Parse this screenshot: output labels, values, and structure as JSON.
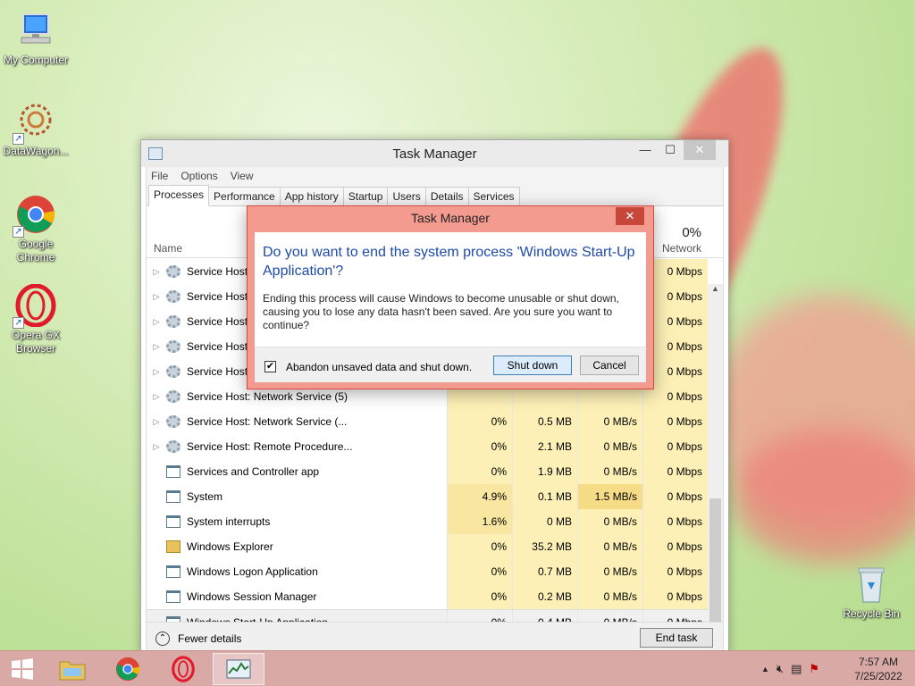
{
  "desktop": {
    "icons": [
      {
        "label": "My Computer",
        "icon": "computer-icon"
      },
      {
        "label": "DataWagon...",
        "icon": "datawagon-icon"
      },
      {
        "label": "Google Chrome",
        "icon": "chrome-icon"
      },
      {
        "label": "Opera GX Browser",
        "icon": "opera-gx-icon"
      },
      {
        "label": "Recycle Bin",
        "icon": "recycle-bin-icon"
      }
    ]
  },
  "task_manager": {
    "title": "Task Manager",
    "menu": [
      "File",
      "Options",
      "View"
    ],
    "tabs": [
      "Processes",
      "Performance",
      "App history",
      "Startup",
      "Users",
      "Details",
      "Services"
    ],
    "active_tab": "Processes",
    "columns": {
      "name": "Name",
      "network_pct": "0%",
      "network": "Network"
    },
    "processes": [
      {
        "name": "Service Host: ...",
        "cpu": "",
        "memory": "",
        "disk": "",
        "network": "0 Mbps",
        "expandable": true,
        "icon": "gear-icon"
      },
      {
        "name": "Service Host: ...",
        "cpu": "",
        "memory": "",
        "disk": "",
        "network": "0 Mbps",
        "expandable": true,
        "icon": "gear-icon"
      },
      {
        "name": "Service Host: ...",
        "cpu": "",
        "memory": "",
        "disk": "",
        "network": "0 Mbps",
        "expandable": true,
        "icon": "gear-icon"
      },
      {
        "name": "Service Host: ...",
        "cpu": "",
        "memory": "",
        "disk": "",
        "network": "0 Mbps",
        "expandable": true,
        "icon": "gear-icon"
      },
      {
        "name": "Service Host: ...",
        "cpu": "",
        "memory": "",
        "disk": "",
        "network": "0 Mbps",
        "expandable": true,
        "icon": "gear-icon"
      },
      {
        "name": "Service Host: Network Service (5)",
        "cpu": "",
        "memory": "",
        "disk": "",
        "network": "0 Mbps",
        "expandable": true,
        "icon": "gear-icon"
      },
      {
        "name": "Service Host: Network Service (...",
        "cpu": "0%",
        "memory": "0.5 MB",
        "disk": "0 MB/s",
        "network": "0 Mbps",
        "expandable": true,
        "icon": "gear-icon"
      },
      {
        "name": "Service Host: Remote Procedure...",
        "cpu": "0%",
        "memory": "2.1 MB",
        "disk": "0 MB/s",
        "network": "0 Mbps",
        "expandable": true,
        "icon": "gear-icon"
      },
      {
        "name": "Services and Controller app",
        "cpu": "0%",
        "memory": "1.9 MB",
        "disk": "0 MB/s",
        "network": "0 Mbps",
        "expandable": false,
        "icon": "app-window-icon"
      },
      {
        "name": "System",
        "cpu": "4.9%",
        "memory": "0.1 MB",
        "disk": "1.5 MB/s",
        "network": "0 Mbps",
        "expandable": false,
        "icon": "app-window-icon"
      },
      {
        "name": "System interrupts",
        "cpu": "1.6%",
        "memory": "0 MB",
        "disk": "0 MB/s",
        "network": "0 Mbps",
        "expandable": false,
        "icon": "app-window-icon"
      },
      {
        "name": "Windows Explorer",
        "cpu": "0%",
        "memory": "35.2 MB",
        "disk": "0 MB/s",
        "network": "0 Mbps",
        "expandable": false,
        "icon": "folder-icon"
      },
      {
        "name": "Windows Logon Application",
        "cpu": "0%",
        "memory": "0.7 MB",
        "disk": "0 MB/s",
        "network": "0 Mbps",
        "expandable": false,
        "icon": "app-window-icon"
      },
      {
        "name": "Windows Session Manager",
        "cpu": "0%",
        "memory": "0.2 MB",
        "disk": "0 MB/s",
        "network": "0 Mbps",
        "expandable": false,
        "icon": "app-window-icon"
      },
      {
        "name": "Windows Start-Up Application",
        "cpu": "0%",
        "memory": "0.4 MB",
        "disk": "0 MB/s",
        "network": "0 Mbps",
        "expandable": false,
        "icon": "app-window-icon",
        "selected": true
      }
    ],
    "fewer_details": "Fewer details",
    "end_task": "End task"
  },
  "dialog": {
    "title": "Task Manager",
    "question": "Do you want to end the system process 'Windows Start-Up Application'?",
    "message": "Ending this process will cause Windows to become unusable or shut down, causing you to lose any data hasn't been saved. Are you sure you want to continue?",
    "checkbox_label": "Abandon unsaved data and shut down.",
    "checkbox_checked": true,
    "shutdown_label": "Shut down",
    "cancel_label": "Cancel"
  },
  "taskbar": {
    "items": [
      "windows-start-icon",
      "file-explorer-icon",
      "chrome-icon",
      "opera-icon",
      "task-manager-icon"
    ],
    "time": "7:57 AM",
    "date": "7/25/2022"
  },
  "colors": {
    "dialog_frame": "#f39b8f",
    "dialog_question": "#1e4aa8",
    "taskbar": "#d9a9a6",
    "highlight": "#fcf0b6"
  }
}
